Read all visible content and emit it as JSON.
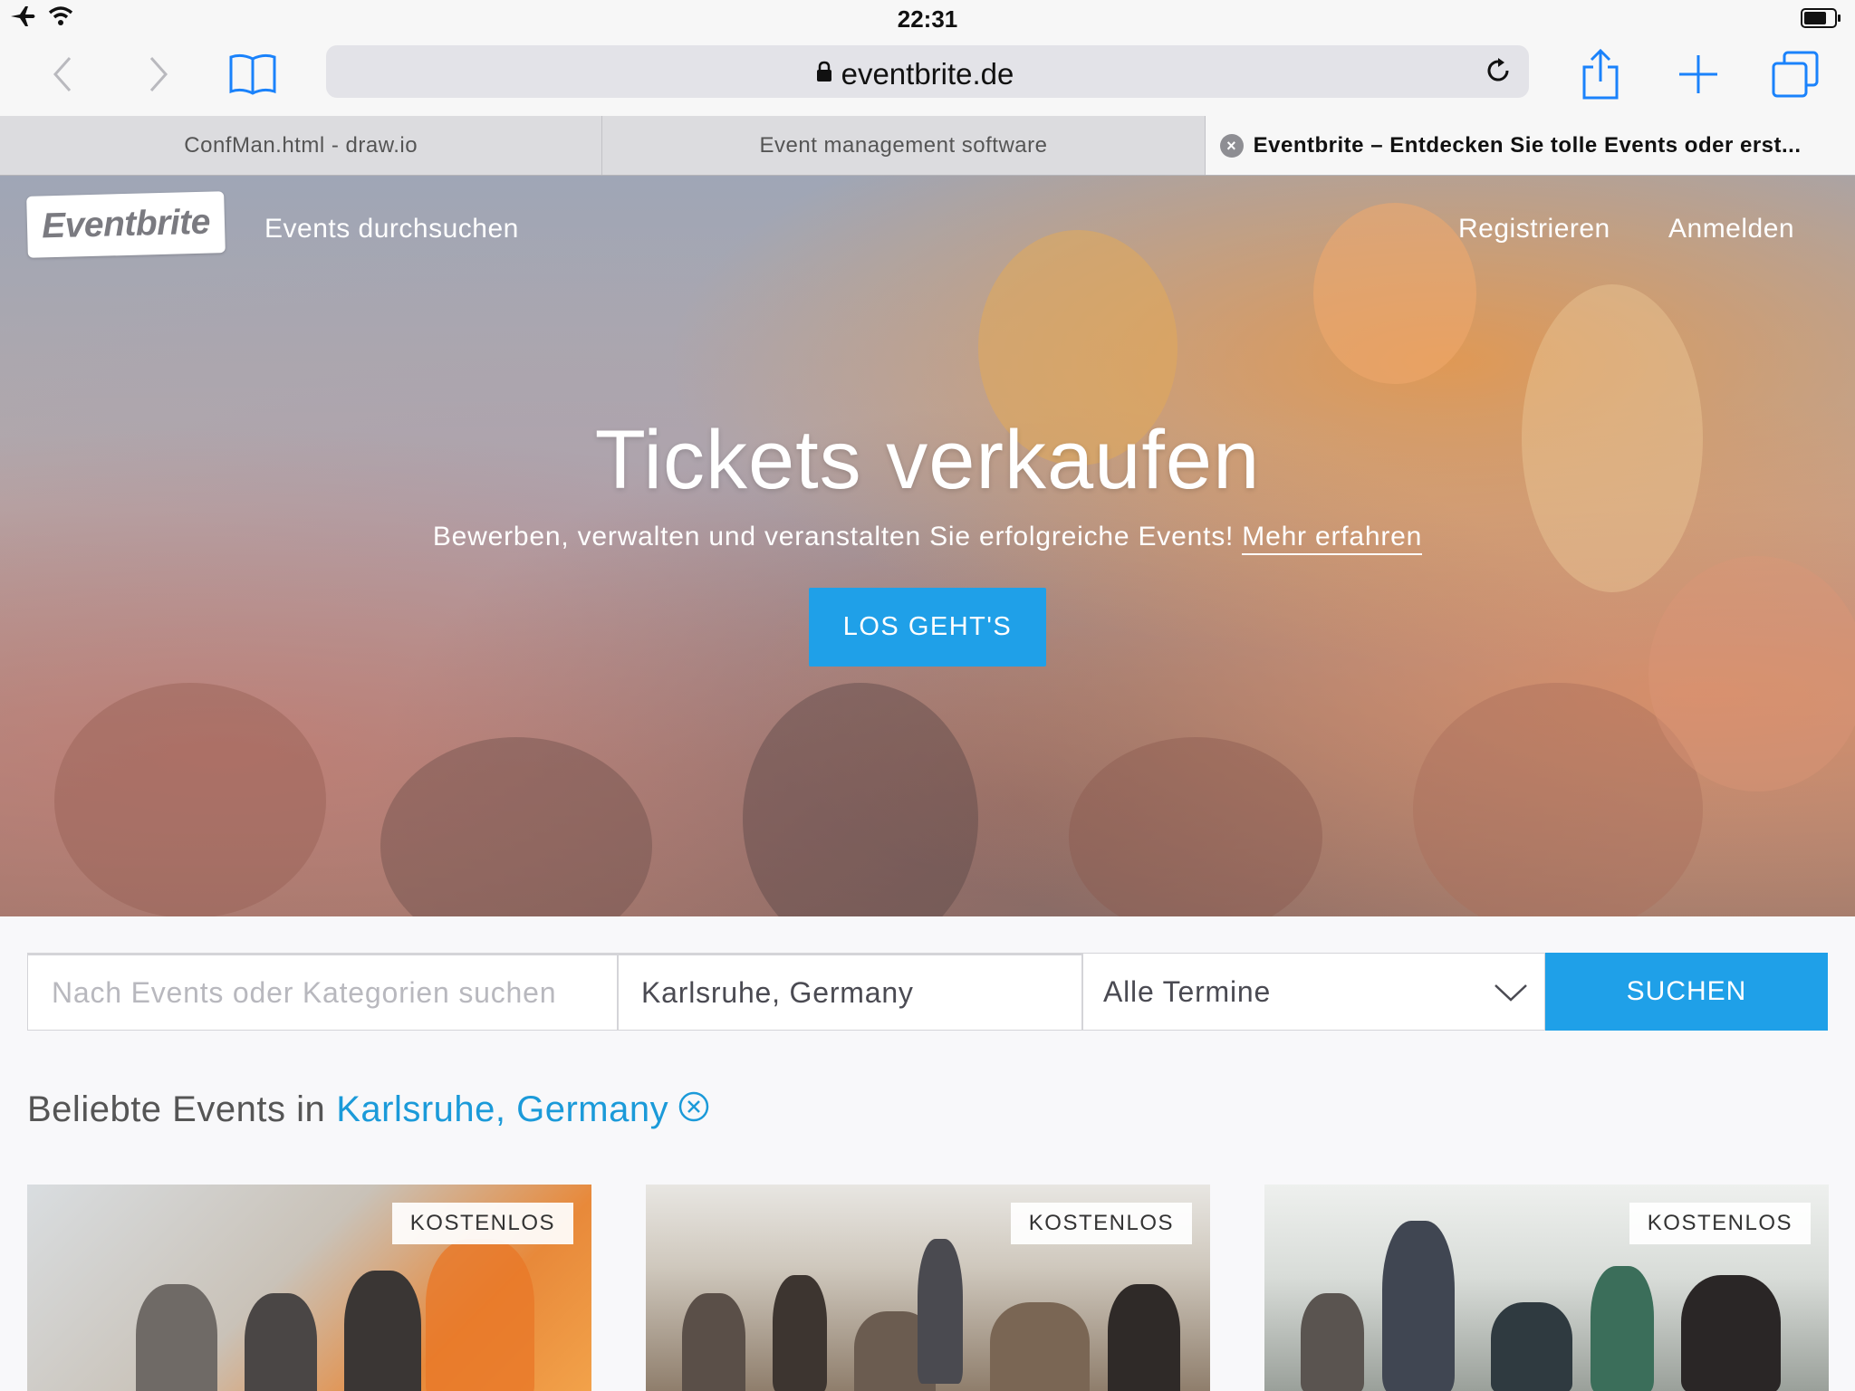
{
  "status_bar": {
    "time": "22:31"
  },
  "browser": {
    "url": "eventbrite.de",
    "tabs": [
      {
        "label": "ConfMan.html - draw.io"
      },
      {
        "label": "Event management software"
      },
      {
        "label": "Eventbrite – Entdecken Sie tolle Events oder erst..."
      }
    ]
  },
  "header": {
    "logo": "Eventbrite",
    "browse": "Events durchsuchen",
    "register": "Registrieren",
    "login": "Anmelden"
  },
  "hero": {
    "title": "Tickets verkaufen",
    "subtitle": "Bewerben, verwalten und veranstalten Sie erfolgreiche Events!",
    "more_link": "Mehr erfahren",
    "cta": "LOS GEHT'S"
  },
  "search": {
    "placeholder": "Nach Events oder Kategorien suchen",
    "location": "Karlsruhe, Germany",
    "date": "Alle Termine",
    "button": "SUCHEN"
  },
  "popular": {
    "prefix": "Beliebte Events in",
    "city": "Karlsruhe, Germany"
  },
  "cards": [
    {
      "badge": "KOSTENLOS"
    },
    {
      "badge": "KOSTENLOS"
    },
    {
      "badge": "KOSTENLOS"
    }
  ],
  "colors": {
    "accent": "#1fa0e8",
    "link": "#1b9ad9",
    "safari_blue": "#1a82fb"
  }
}
